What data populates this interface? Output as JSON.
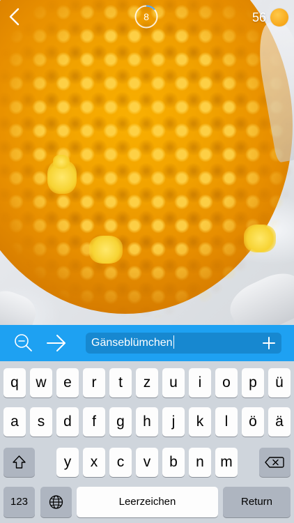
{
  "topbar": {
    "timer_value": "8",
    "coins_count": "56",
    "back_icon": "chevron-left-icon",
    "coin_icon": "coin-icon",
    "colors": {
      "coin": "#f7a719",
      "timer_ring": "#ffffff",
      "timer_progress": "#4aa7ff"
    }
  },
  "guess": {
    "value": "Gänseblümchen",
    "icons": [
      "zoom-out-icon",
      "arrow-right-icon",
      "plus-icon"
    ],
    "colors": {
      "bar": "#1ea1f2",
      "field": "#1788d0"
    }
  },
  "keyboard": {
    "row1": [
      "q",
      "w",
      "e",
      "r",
      "t",
      "z",
      "u",
      "i",
      "o",
      "p",
      "ü"
    ],
    "row2": [
      "a",
      "s",
      "d",
      "f",
      "g",
      "h",
      "j",
      "k",
      "l",
      "ö",
      "ä"
    ],
    "row3": [
      "y",
      "x",
      "c",
      "v",
      "b",
      "n",
      "m"
    ],
    "shift_icon": "shift-icon",
    "delete_icon": "backspace-icon",
    "numbers_label": "123",
    "globe_icon": "globe-icon",
    "space_label": "Leerzeichen",
    "return_label": "Return"
  }
}
